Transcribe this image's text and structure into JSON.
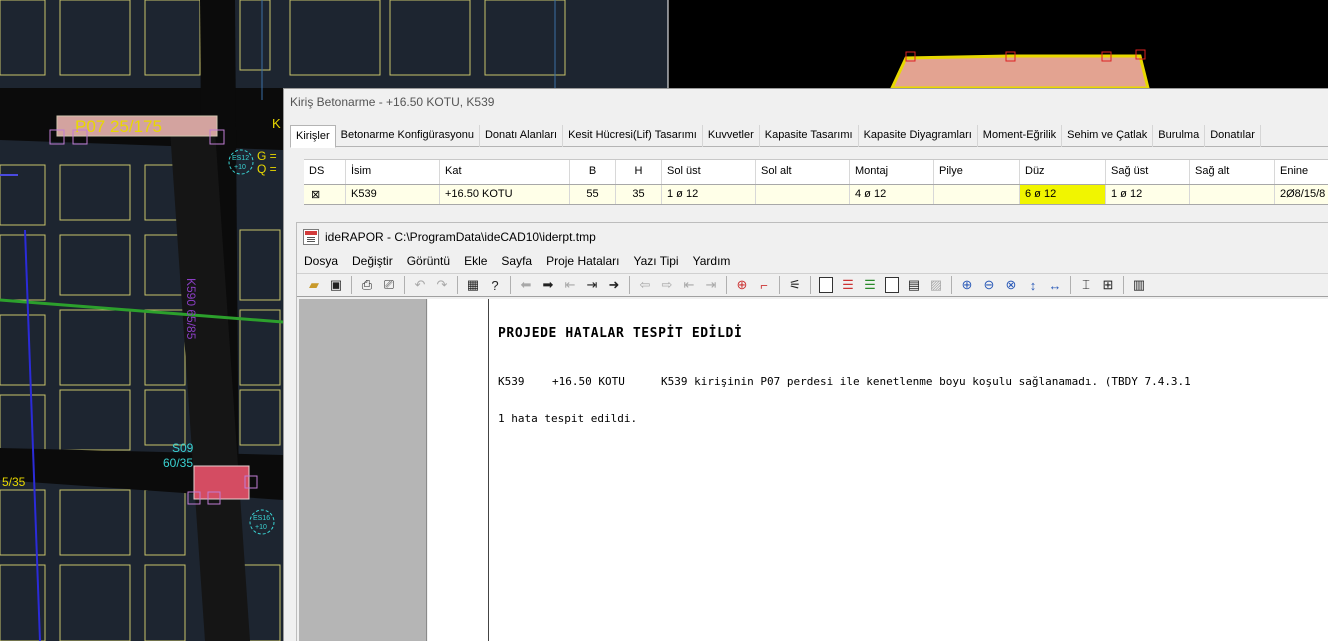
{
  "cad": {
    "labels": {
      "p07": "P07 25/175",
      "k590": "K590 65/85",
      "s09_name": "S09",
      "s09_dim": "60/35",
      "left_dim": "5/35",
      "k_prefix": "K",
      "g_label": "G =",
      "q_label": "Q =",
      "circle_1_top": "ES12",
      "circle_1_bottom": "+10",
      "circle_2_top": "ES16",
      "circle_2_bottom": "+10"
    }
  },
  "kiris_window": {
    "title": "Kiriş Betonarme - +16.50 KOTU, K539",
    "tabs": [
      {
        "label": "Kirişler",
        "active": true
      },
      {
        "label": "Betonarme Konfigürasyonu"
      },
      {
        "label": "Donatı Alanları"
      },
      {
        "label": "Kesit Hücresi(Lif) Tasarımı"
      },
      {
        "label": "Kuvvetler"
      },
      {
        "label": "Kapasite Tasarımı"
      },
      {
        "label": "Kapasite Diyagramları"
      },
      {
        "label": "Moment-Eğrilik"
      },
      {
        "label": "Sehim ve Çatlak"
      },
      {
        "label": "Burulma"
      },
      {
        "label": "Donatılar"
      }
    ],
    "grid": {
      "headers": [
        "DS",
        "İsim",
        "Kat",
        "B",
        "H",
        "Sol üst",
        "Sol alt",
        "Montaj",
        "Pilye",
        "Düz",
        "Sağ üst",
        "Sağ alt",
        "Enine"
      ],
      "row": [
        "⊠",
        "K539",
        "+16.50 KOTU",
        "55",
        "35",
        "1 ø 12",
        "",
        "4 ø 12",
        "",
        "6 ø 12",
        "1 ø 12",
        "",
        "2Ø8/15/8"
      ],
      "highlight_color": "#f1f500"
    }
  },
  "report_window": {
    "title": "ideRAPOR - C:\\ProgramData\\ideCAD10\\iderpt.tmp",
    "menu": [
      "Dosya",
      "Değiştir",
      "Görüntü",
      "Ekle",
      "Sayfa",
      "Proje Hataları",
      "Yazı Tipi",
      "Yardım"
    ],
    "heading": "PROJEDE HATALAR TESPİT EDİLDİ",
    "error": {
      "beam": "K539",
      "floor": "+16.50 KOTU",
      "message": "K539 kirişinin P07 perdesi ile kenetlenme boyu koşulu sağlanamadı. (TBDY 7.4.3.1"
    },
    "summary": "1 hata tespit edildi."
  }
}
